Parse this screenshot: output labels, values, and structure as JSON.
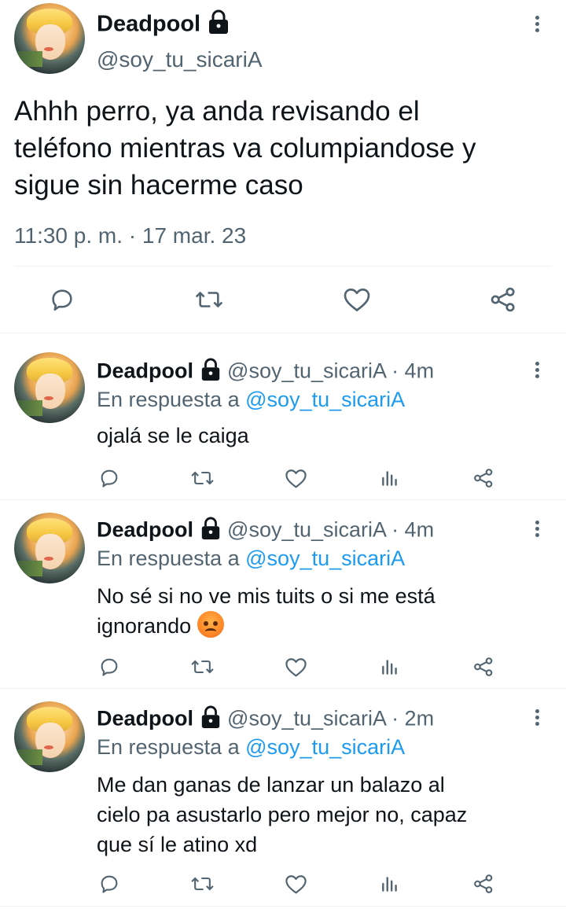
{
  "main_tweet": {
    "name": "Deadpool",
    "handle": "@soy_tu_sicariA",
    "text_lines": [
      "Ahhh perro, ya anda revisando el",
      "teléfono mientras va columpiandose y",
      "sigue sin hacerme caso"
    ],
    "timestamp": "11:30 p. m. · 17 mar. 23",
    "icons": [
      "reply-icon",
      "retweet-icon",
      "like-icon",
      "share-icon"
    ]
  },
  "replies": [
    {
      "name": "Deadpool",
      "handle": "@soy_tu_sicariA",
      "age": "· 4m",
      "reply_prefix": "En respuesta a",
      "reply_to": "@soy_tu_sicariA",
      "text_lines": [
        "ojalá se le caiga"
      ]
    },
    {
      "name": "Deadpool",
      "handle": "@soy_tu_sicariA",
      "age": "· 4m",
      "reply_prefix": "En respuesta a",
      "reply_to": "@soy_tu_sicariA",
      "text_lines": [
        "No sé si no ve mis tuits o si me está",
        "ignorando"
      ],
      "emoji": "angry-face-emoji"
    },
    {
      "name": "Deadpool",
      "handle": "@soy_tu_sicariA",
      "age": "· 2m",
      "reply_prefix": "En respuesta a",
      "reply_to": "@soy_tu_sicariA",
      "text_lines": [
        "Me dan ganas de lanzar un balazo al",
        "cielo pa asustarlo pero mejor no, capaz",
        "que sí le atino xd"
      ]
    }
  ],
  "colors": {
    "text": "#0f1419",
    "secondary": "#536471",
    "link": "#1d9bf0",
    "divider": "#eff3f4"
  }
}
